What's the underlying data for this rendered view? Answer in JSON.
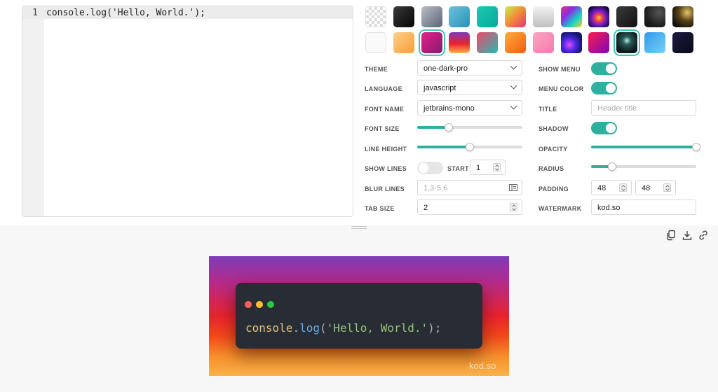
{
  "editor": {
    "line_number": "1",
    "code": "console.log('Hello, World.');"
  },
  "backgrounds": {
    "selected_index": 14,
    "swatches": [
      {
        "name": "transparent"
      },
      {
        "name": "black",
        "css": "linear-gradient(135deg,#3a3a3a,#050505)"
      },
      {
        "name": "slate",
        "css": "linear-gradient(135deg,#b8bdc8,#5d6474)"
      },
      {
        "name": "ocean-blue",
        "css": "linear-gradient(135deg,#6cc3dc,#2a8fb8)"
      },
      {
        "name": "teal",
        "css": "linear-gradient(135deg,#19cbb0,#0aa89a)"
      },
      {
        "name": "lime-pink",
        "css": "linear-gradient(135deg,#c8f04a,#f08a3a,#e8327a)"
      },
      {
        "name": "silver",
        "css": "linear-gradient(180deg,#f2f2f2,#bfbfbf)"
      },
      {
        "name": "rainbow",
        "css": "linear-gradient(135deg,#e8327a,#8a2be2,#12d2c8,#f5d024)"
      },
      {
        "name": "neon-burst",
        "css": "radial-gradient(circle at 50% 55%,#ffd84a 0%,#ff4a3a 20%,#7a1cc8 45%,#140a40 80%)"
      },
      {
        "name": "dark-gray",
        "css": "linear-gradient(135deg,#3a3a3a,#111)"
      },
      {
        "name": "graphite",
        "css": "radial-gradient(circle at 70% 30%,#555 0%,#1a1a1a 70%)"
      },
      {
        "name": "golden-night",
        "css": "radial-gradient(circle at 70% 30%,#e8c56a 0%,#5a4418 40%,#111 80%)"
      },
      {
        "name": "white"
      },
      {
        "name": "peach",
        "css": "linear-gradient(135deg,#fdd089,#f99d3a)"
      },
      {
        "name": "magenta",
        "css": "linear-gradient(135deg,#e0218a,#8a1a6e)"
      },
      {
        "name": "sunset",
        "css": "linear-gradient(180deg,#7d3cb8,#e8222e 55%,#f9b24a)"
      },
      {
        "name": "coral-teal",
        "css": "linear-gradient(135deg,#f24a6a,#28b6b0)"
      },
      {
        "name": "orange",
        "css": "linear-gradient(135deg,#ffae3a,#f55a10)"
      },
      {
        "name": "pink-peach",
        "css": "linear-gradient(135deg,#f7a7c0,#f77ab0)"
      },
      {
        "name": "aurora",
        "css": "radial-gradient(circle at 40% 60%,#e84aff 0%,#4a2ae0 35%,#12126a 75%)"
      },
      {
        "name": "crimson-violet",
        "css": "linear-gradient(135deg,#ff1a4a,#7a0ab8)"
      },
      {
        "name": "starfield",
        "css": "radial-gradient(circle at 50% 40%,#b4ece4 0%,#2a5a58 25%,#0c1a1a 70%)"
      },
      {
        "name": "sky-blue",
        "css": "linear-gradient(135deg,#2e9ae8,#7ad0f8)"
      },
      {
        "name": "midnight",
        "css": "linear-gradient(135deg,#1a1a40,#0a0a1a)"
      }
    ]
  },
  "settings": {
    "theme": {
      "label": "THEME",
      "value": "one-dark-pro"
    },
    "language": {
      "label": "LANGUAGE",
      "value": "javascript"
    },
    "font_name": {
      "label": "FONT NAME",
      "value": "jetbrains-mono"
    },
    "font_size": {
      "label": "FONT SIZE",
      "level": 0.3
    },
    "line_height": {
      "label": "LINE HEIGHT",
      "level": 0.5
    },
    "show_lines": {
      "label": "SHOW LINES",
      "on": false,
      "start_label": "START",
      "start_value": "1"
    },
    "blur_lines": {
      "label": "BLUR LINES",
      "placeholder": "1,3-5,6"
    },
    "tab_size": {
      "label": "TAB SIZE",
      "value": "2"
    },
    "show_menu": {
      "label": "SHOW MENU",
      "on": true
    },
    "menu_color": {
      "label": "MENU COLOR",
      "on": true
    },
    "title": {
      "label": "TITLE",
      "placeholder": "Header title"
    },
    "shadow": {
      "label": "SHADOW",
      "on": true
    },
    "opacity": {
      "label": "OPACITY",
      "level": 1.0
    },
    "radius": {
      "label": "RADIUS",
      "level": 0.2
    },
    "padding": {
      "label": "PADDING",
      "x": "48",
      "y": "48"
    },
    "watermark": {
      "label": "WATERMARK",
      "value": "kod.so"
    }
  },
  "toolbar": {
    "icons": [
      "copy-icon",
      "download-icon",
      "link-icon"
    ]
  },
  "preview": {
    "code_tokens": [
      {
        "text": "console",
        "color": "#e5c07b"
      },
      {
        "text": ".",
        "color": "#abb2bf"
      },
      {
        "text": "log",
        "color": "#61afef"
      },
      {
        "text": "(",
        "color": "#abb2bf"
      },
      {
        "text": "'Hello, World.'",
        "color": "#98c379"
      },
      {
        "text": ");",
        "color": "#abb2bf"
      }
    ],
    "window_dots": [
      "#ff5f56",
      "#ffbd2e",
      "#27c93f"
    ],
    "watermark": "kod.so"
  }
}
